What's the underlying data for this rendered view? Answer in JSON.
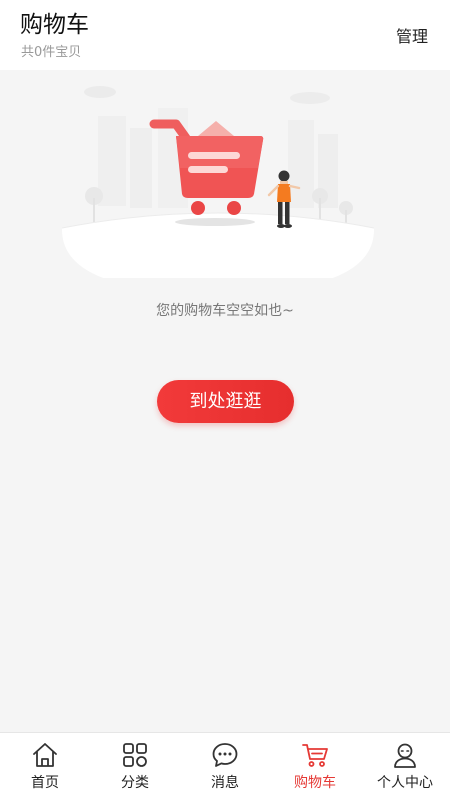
{
  "header": {
    "title": "购物车",
    "subtitle": "共0件宝贝",
    "manage_label": "管理"
  },
  "empty": {
    "message": "您的购物车空空如也~",
    "button_label": "到处逛逛"
  },
  "tabbar": {
    "items": [
      {
        "label": "首页",
        "icon": "home-icon",
        "active": false
      },
      {
        "label": "分类",
        "icon": "category-icon",
        "active": false
      },
      {
        "label": "消息",
        "icon": "message-icon",
        "active": false
      },
      {
        "label": "购物车",
        "icon": "cart-icon",
        "active": true
      },
      {
        "label": "个人中心",
        "icon": "profile-icon",
        "active": false
      }
    ]
  },
  "colors": {
    "accent": "#e53935",
    "button": "#f23a3a",
    "background": "#f5f5f5",
    "muted_text": "#999999"
  }
}
